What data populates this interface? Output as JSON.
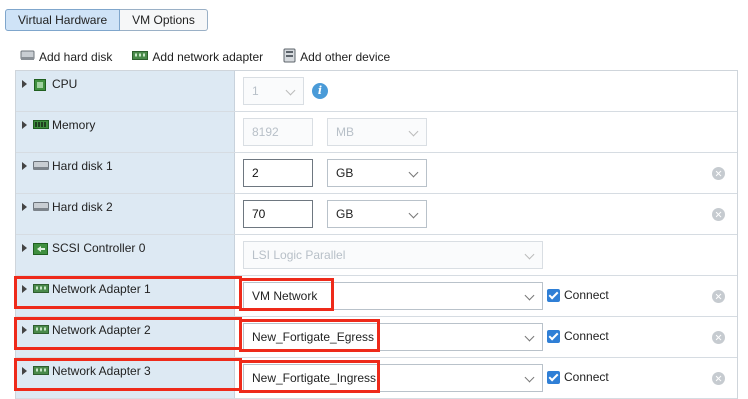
{
  "tabs": [
    {
      "label": "Virtual Hardware",
      "active": true
    },
    {
      "label": "VM Options",
      "active": false
    }
  ],
  "toolbar": {
    "add_hard_disk": "Add hard disk",
    "add_network_adapter": "Add network adapter",
    "add_other_device": "Add other device"
  },
  "rows": {
    "cpu": {
      "label": "CPU",
      "value": "1",
      "icon": "cpu-icon"
    },
    "memory": {
      "label": "Memory",
      "value": "8192",
      "unit": "MB",
      "icon": "memory-icon"
    },
    "hard_disk_1": {
      "label": "Hard disk 1",
      "value": "2",
      "unit": "GB",
      "icon": "hard-disk-icon"
    },
    "hard_disk_2": {
      "label": "Hard disk 2",
      "value": "70",
      "unit": "GB",
      "icon": "hard-disk-icon"
    },
    "scsi": {
      "label": "SCSI Controller 0",
      "value": "LSI Logic Parallel",
      "icon": "scsi-controller-icon"
    },
    "network_1": {
      "label": "Network Adapter 1",
      "value": "VM Network",
      "connect_label": "Connect",
      "connected": true,
      "icon": "network-adapter-icon"
    },
    "network_2": {
      "label": "Network Adapter 2",
      "value": "New_Fortigate_Egress",
      "connect_label": "Connect",
      "connected": true,
      "icon": "network-adapter-icon"
    },
    "network_3": {
      "label": "Network Adapter 3",
      "value": "New_Fortigate_Ingress",
      "connect_label": "Connect",
      "connected": true,
      "icon": "network-adapter-icon"
    }
  },
  "colors": {
    "highlight": "#ee2a1a",
    "label_bg": "#dde9f3",
    "checkbox": "#2f7fd6",
    "info": "#4a9bd8"
  }
}
